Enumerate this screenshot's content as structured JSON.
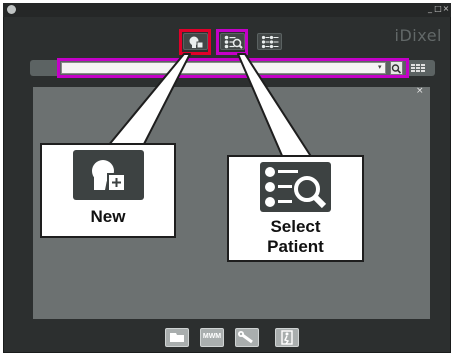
{
  "window": {
    "brand": "iDixel",
    "controls": [
      "_",
      "□",
      "×"
    ]
  },
  "search": {
    "value": "",
    "dropdown_arrow": "▾"
  },
  "panel": {
    "close_glyph": "×"
  },
  "callouts": {
    "new_label": "New",
    "select_label_line1": "Select",
    "select_label_line2": "Patient"
  },
  "bottom_toolbar": {
    "mwm_label": "MWM"
  },
  "colors": {
    "highlight_red": "#e0002a",
    "highlight_magenta": "#c400c8",
    "app_background": "#2c2f2f",
    "panel_background": "#6c7171"
  },
  "icons": {
    "new_patient": "new-patient-icon",
    "select_patient": "select-patient-icon",
    "list": "patient-list-icon",
    "search": "search-icon",
    "grid": "grid-view-icon",
    "folder": "folder-icon",
    "tools": "wrench-icon",
    "exit": "exit-icon"
  }
}
